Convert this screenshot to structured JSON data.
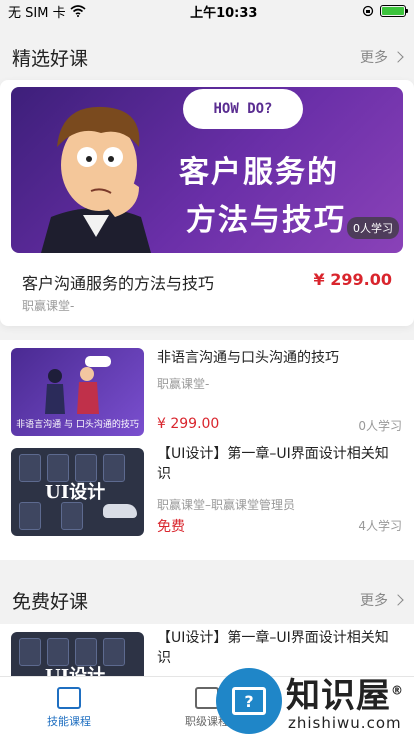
{
  "status_bar": {
    "carrier": "无 SIM 卡",
    "time": "上午10:33"
  },
  "featured_section": {
    "title": "精选好课",
    "more_label": "更多"
  },
  "featured_course": {
    "banner_cloud_text": "HOW DO?",
    "banner_line1": "客户服务的",
    "banner_line2": "方法与技巧",
    "learners": "0人学习",
    "title": "客户沟通服务的方法与技巧",
    "price": "¥ 299.00",
    "provider": "职赢课堂-"
  },
  "course_list": [
    {
      "thumb_caption": "非语言沟通 与 口头沟通的技巧",
      "title": "非语言沟通与口头沟通的技巧",
      "provider": "职赢课堂-",
      "price": "¥ 299.00",
      "learners": "0人学习"
    },
    {
      "thumb_caption": "UI设计",
      "title": "【UI设计】第一章–UI界面设计相关知识",
      "provider": "职赢课堂–职赢课堂管理员",
      "price": "免费",
      "learners": "4人学习"
    }
  ],
  "free_section": {
    "title": "免费好课",
    "more_label": "更多",
    "first_course": {
      "thumb_caption": "UI设计",
      "title": "【UI设计】第一章–UI界面设计相关知识"
    }
  },
  "tabbar": {
    "items": [
      {
        "label": "技能课程",
        "active": true
      },
      {
        "label": "职级课程",
        "active": false
      }
    ]
  },
  "watermark": {
    "big": "知识屋",
    "registered": "®",
    "small": "zhishiwu.com",
    "screen_text": "?"
  },
  "colors": {
    "accent": "#1f6fc1",
    "price": "#d9252d",
    "muted": "#999999"
  }
}
